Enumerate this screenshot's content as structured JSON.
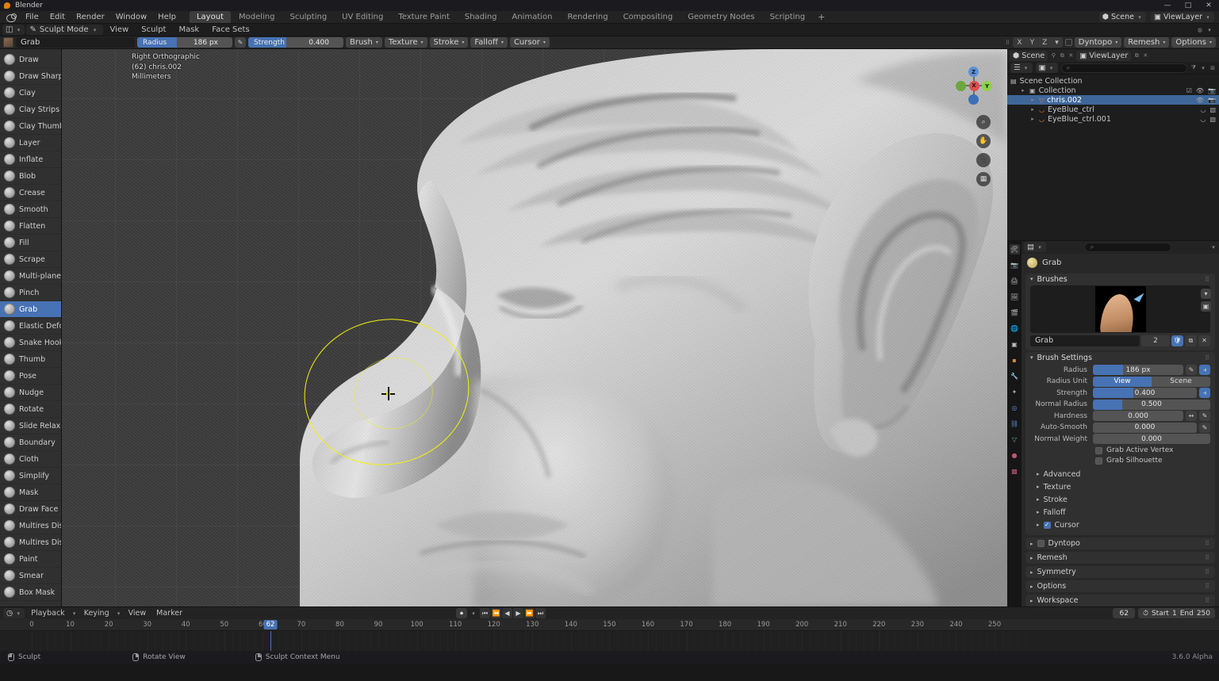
{
  "window": {
    "title": "Blender",
    "minimize": "—",
    "maximize": "□",
    "close": "✕"
  },
  "topbar": {
    "menus": [
      "File",
      "Edit",
      "Render",
      "Window",
      "Help"
    ],
    "workspaces": [
      "Layout",
      "Modeling",
      "Sculpting",
      "UV Editing",
      "Texture Paint",
      "Shading",
      "Animation",
      "Rendering",
      "Compositing",
      "Geometry Nodes",
      "Scripting"
    ],
    "active_workspace": "Layout",
    "add_workspace": "+",
    "scene_label": "Scene",
    "viewlayer_label": "ViewLayer"
  },
  "modebar": {
    "mode": "Sculpt Mode",
    "menus": [
      "View",
      "Sculpt",
      "Mask",
      "Face Sets"
    ]
  },
  "toolheader": {
    "brush_name": "Grab",
    "radius_label": "Radius",
    "radius_value": "186 px",
    "radius_fill_pct": 42,
    "strength_label": "Strength",
    "strength_value": "0.400",
    "strength_fill_pct": 40,
    "dropdowns": [
      "Brush",
      "Texture",
      "Stroke",
      "Falloff",
      "Cursor"
    ],
    "axes": [
      "X",
      "Y",
      "Z"
    ],
    "dyntopo_label": "Dyntopo",
    "remesh_label": "Remesh",
    "options_label": "Options"
  },
  "toolbar": {
    "active_tool": "Grab",
    "tools": [
      "Draw",
      "Draw Sharp",
      "Clay",
      "Clay Strips",
      "Clay Thumb",
      "Layer",
      "Inflate",
      "Blob",
      "Crease",
      "Smooth",
      "Flatten",
      "Fill",
      "Scrape",
      "Multi-plane S...",
      "Pinch",
      "Grab",
      "Elastic Deform",
      "Snake Hook",
      "Thumb",
      "Pose",
      "Nudge",
      "Rotate",
      "Slide Relax",
      "Boundary",
      "Cloth",
      "Simplify",
      "Mask",
      "Draw Face S...",
      "Multires Dis...",
      "Multires Dis...",
      "Paint",
      "Smear",
      "Box Mask"
    ]
  },
  "viewport": {
    "view_name": "Right Orthographic",
    "object_line": "(62) chris.002",
    "units": "Millimeters",
    "gizmo_axes": {
      "z": "Z",
      "x": "X",
      "y": "Y"
    },
    "cursor_color": "#f2f20c",
    "nav_tools": [
      "zoom-icon",
      "hand-icon",
      "camera-icon",
      "grid-icon"
    ]
  },
  "outliner": {
    "scene": "Scene",
    "viewlayer": "ViewLayer",
    "search_placeholder": "",
    "rows": [
      {
        "label": "Scene Collection",
        "depth": 0,
        "selected": false
      },
      {
        "label": "Collection",
        "depth": 1,
        "selected": false
      },
      {
        "label": "chris.002",
        "depth": 2,
        "selected": true
      },
      {
        "label": "EyeBlue_ctrl",
        "depth": 2,
        "selected": false
      },
      {
        "label": "EyeBlue_ctrl.001",
        "depth": 2,
        "selected": false
      }
    ]
  },
  "properties": {
    "brush_header": "Grab",
    "brushes_panel": {
      "title": "Brushes",
      "datablock_name": "Grab",
      "users_count": "2"
    },
    "brush_settings": {
      "title": "Brush Settings",
      "fields": [
        {
          "label": "Radius",
          "value": "186 px",
          "fill": 33,
          "type": "slider"
        },
        {
          "label": "Radius Unit",
          "options": [
            "View",
            "Scene"
          ],
          "selected": "View",
          "type": "segmented"
        },
        {
          "label": "Strength",
          "value": "0.400",
          "fill": 39,
          "type": "slider"
        },
        {
          "label": "Normal Radius",
          "value": "0.500",
          "fill": 25,
          "type": "slider"
        },
        {
          "label": "Hardness",
          "value": "0.000",
          "fill": 0,
          "type": "slider"
        },
        {
          "label": "Auto-Smooth",
          "value": "0.000",
          "fill": 0,
          "type": "slider"
        },
        {
          "label": "Normal Weight",
          "value": "0.000",
          "fill": 0,
          "type": "slider"
        }
      ],
      "checkboxes": [
        {
          "label": "Grab Active Vertex",
          "checked": false
        },
        {
          "label": "Grab Silhouette",
          "checked": false
        }
      ],
      "subpanels": [
        {
          "label": "Advanced",
          "checkbox": null
        },
        {
          "label": "Texture",
          "checkbox": null
        },
        {
          "label": "Stroke",
          "checkbox": null
        },
        {
          "label": "Falloff",
          "checkbox": null
        },
        {
          "label": "Cursor",
          "checkbox": true
        }
      ]
    },
    "closed_panels": [
      {
        "label": "Dyntopo",
        "checkbox": false
      },
      {
        "label": "Remesh",
        "checkbox": null
      },
      {
        "label": "Symmetry",
        "checkbox": null
      },
      {
        "label": "Options",
        "checkbox": null
      },
      {
        "label": "Workspace",
        "checkbox": null
      }
    ]
  },
  "timeline": {
    "menus": [
      "Playback",
      "Keying",
      "View",
      "Marker"
    ],
    "current_frame": "62",
    "start_label": "Start",
    "start_value": "1",
    "end_label": "End",
    "end_value": "250",
    "ticks": [
      0,
      10,
      20,
      30,
      40,
      50,
      60,
      70,
      80,
      90,
      100,
      110,
      120,
      130,
      140,
      150,
      160,
      170,
      180,
      190,
      200,
      210,
      220,
      230,
      240,
      250
    ],
    "playhead_frame": 62
  },
  "statusbar": {
    "items": [
      {
        "icon": "mouse-left-icon",
        "label": "Sculpt"
      },
      {
        "icon": "mouse-middle-icon",
        "label": "Rotate View"
      },
      {
        "icon": "mouse-right-icon",
        "label": "Sculpt Context Menu"
      }
    ],
    "version": "3.6.0 Alpha"
  }
}
